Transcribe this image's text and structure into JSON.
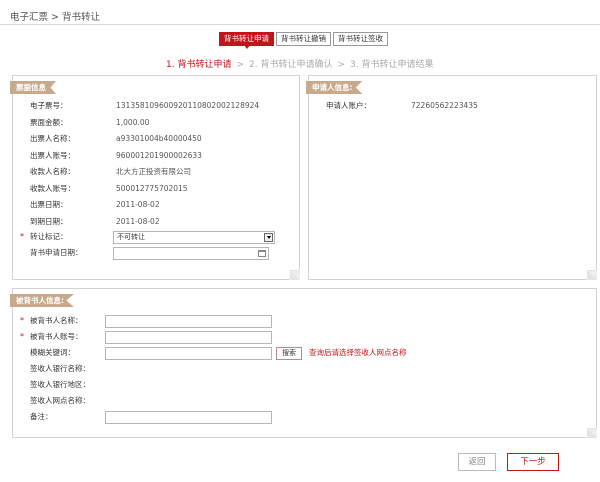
{
  "breadcrumb": "电子汇票 > 背书转让",
  "tabs": [
    "背书转让申请",
    "背书转让撤销",
    "背书转让签收"
  ],
  "steps": [
    "1. 背书转让申请",
    "2. 背书转让申请确认",
    "3. 背书转让申请结果"
  ],
  "step_sep": ">",
  "bill": {
    "title": "票据信息",
    "fields": [
      {
        "label": "电子票号：",
        "value": "131358109600920110802002128924"
      },
      {
        "label": "票面金额：",
        "value": "1,000.00"
      },
      {
        "label": "出票人名称：",
        "value": "a93301004b40000450"
      },
      {
        "label": "出票人账号：",
        "value": "960001201900002633"
      },
      {
        "label": "收款人名称：",
        "value": "北大方正投资有限公司"
      },
      {
        "label": "收款人账号：",
        "value": "500012775702015"
      },
      {
        "label": "出票日期：",
        "value": "2011-08-02"
      },
      {
        "label": "到期日期：",
        "value": "2011-08-02"
      }
    ],
    "transfer_label": "转让标记：",
    "transfer_value": "不可转让",
    "apply_date_label": "背书申请日期："
  },
  "applicant": {
    "title": "申请人信息:",
    "account_label": "申请人账户：",
    "account_value": "72260562223435"
  },
  "endorsee": {
    "title": "被背书人信息:",
    "name_label": "被背书人名称：",
    "account_label": "被背书人账号：",
    "keyword_label": "模糊关键词：",
    "search_button": "搜索",
    "hint": "查询后请选择签收人网点名称",
    "bank_name_label": "签收人银行名称：",
    "bank_region_label": "签收人银行地区：",
    "branch_label": "签收人网点名称：",
    "remark_label": "备注："
  },
  "star": "*",
  "buttons": {
    "back": "返回",
    "next": "下一步"
  }
}
